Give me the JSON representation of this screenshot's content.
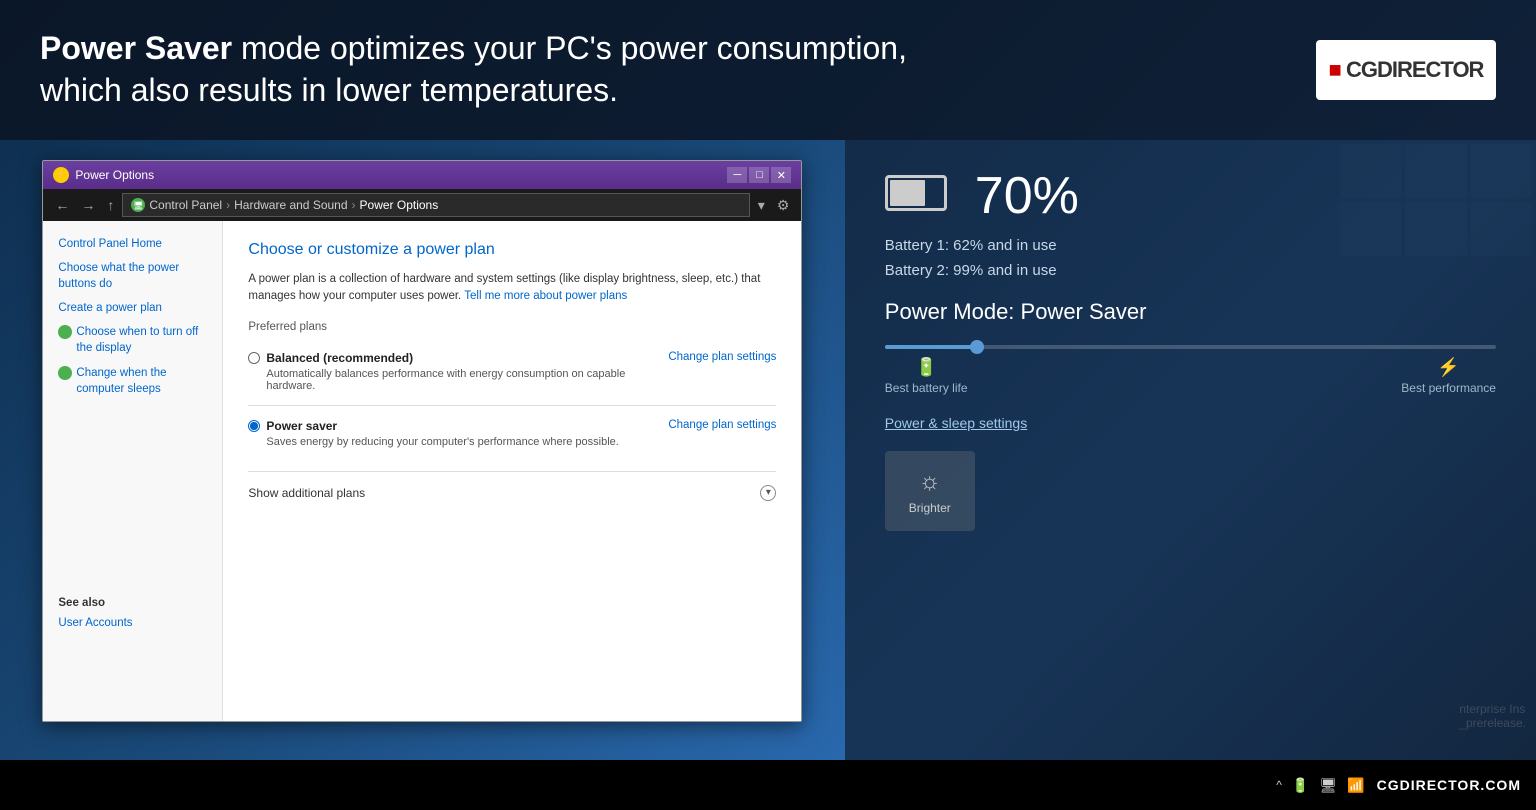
{
  "header": {
    "title_bold": "Power Saver",
    "title_rest": " mode optimizes your PC's power consumption,\nwhich also results in lower temperatures.",
    "logo": "CGDIRECTOR"
  },
  "dialog": {
    "titlebar": {
      "title": "Power Options",
      "controls": [
        "─",
        "□",
        "✕"
      ]
    },
    "toolbar": {
      "nav": [
        "←",
        "→",
        "↑"
      ],
      "address_parts": [
        "Control Panel",
        "Hardware and Sound",
        "Power Options"
      ]
    },
    "sidebar": {
      "home": "Control Panel Home",
      "links": [
        "Choose what the power buttons do",
        "Create a power plan",
        "Choose when to turn off the display",
        "Change when the computer sleeps"
      ],
      "see_also": "See also",
      "user_accounts": "User Accounts"
    },
    "main": {
      "title": "Choose or customize a power plan",
      "description": "A power plan is a collection of hardware and system settings (like display brightness, sleep, etc.) that manages how your computer uses power.",
      "learn_more": "Tell me more about power plans",
      "preferred_plans_label": "Preferred plans",
      "plans": [
        {
          "name": "Balanced (recommended)",
          "description": "Automatically balances performance with energy consumption on capable hardware.",
          "change_link": "Change plan settings",
          "selected": false
        },
        {
          "name": "Power saver",
          "description": "Saves energy by reducing your computer's performance where possible.",
          "change_link": "Change plan settings",
          "selected": true
        }
      ],
      "show_additional": "Show additional plans"
    }
  },
  "battery_panel": {
    "percentage": "70%",
    "battery_fill_width": "70%",
    "battery1": "Battery 1: 62% and in use",
    "battery2": "Battery 2: 99% and in use",
    "power_mode": "Power Mode: Power Saver",
    "slider_fill_pct": "15%",
    "label_left": "Best battery life",
    "label_right": "Best performance",
    "power_sleep_link": "Power & sleep settings",
    "brightness_label": "Brighter"
  },
  "taskbar": {
    "brand": "CGDIRECTOR.COM",
    "icons": [
      "^",
      "🔋",
      "🖥",
      "📶"
    ]
  },
  "enterprise_text": "nterprise Ins\n_prerelease."
}
